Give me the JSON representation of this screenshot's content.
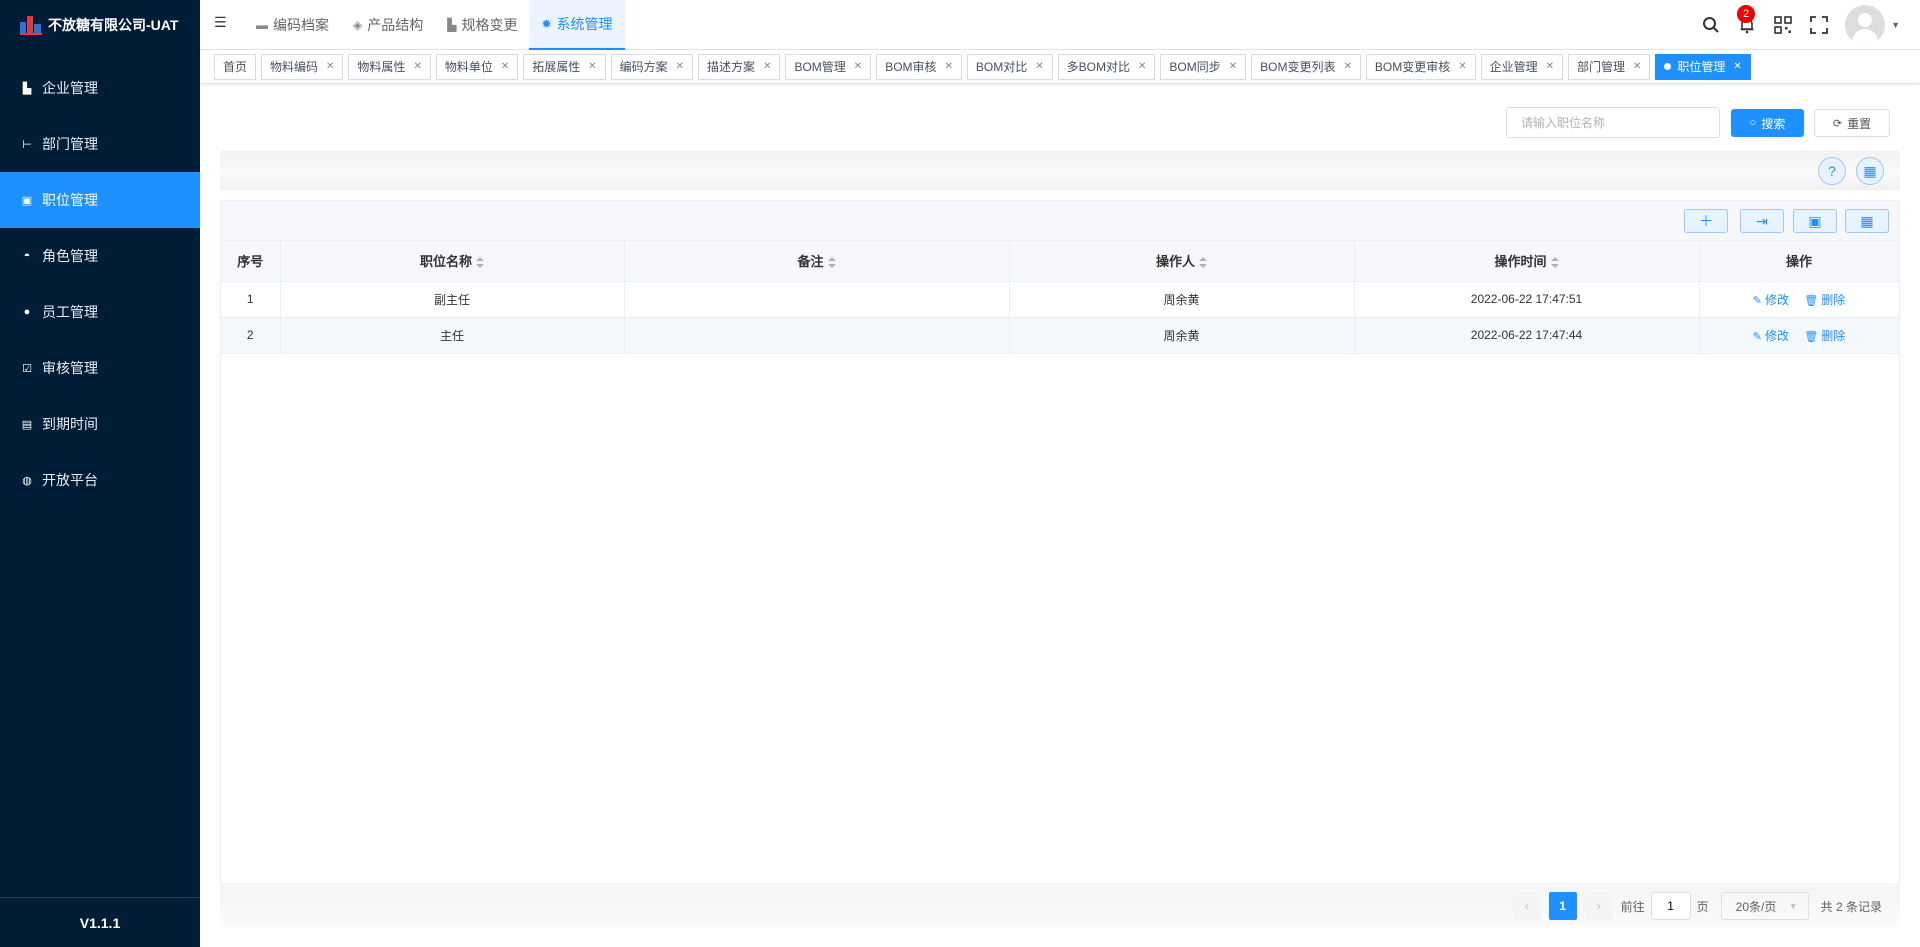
{
  "app": {
    "title": "不放糖有限公司-UAT",
    "version": "V1.1.1"
  },
  "sidebar": {
    "items": [
      {
        "label": "企业管理",
        "icon": "building-icon"
      },
      {
        "label": "部门管理",
        "icon": "tree-icon"
      },
      {
        "label": "职位管理",
        "icon": "id-card-icon",
        "active": true
      },
      {
        "label": "角色管理",
        "icon": "role-icon"
      },
      {
        "label": "员工管理",
        "icon": "user-icon"
      },
      {
        "label": "审核管理",
        "icon": "check-icon"
      },
      {
        "label": "到期时间",
        "icon": "calendar-icon"
      },
      {
        "label": "开放平台",
        "icon": "platform-icon"
      }
    ]
  },
  "topnav": {
    "items": [
      {
        "label": "编码档案"
      },
      {
        "label": "产品结构"
      },
      {
        "label": "规格变更"
      },
      {
        "label": "系统管理",
        "active": true
      }
    ],
    "notification_count": "2"
  },
  "tags": [
    "首页",
    "物料编码",
    "物料属性",
    "物料单位",
    "拓展属性",
    "编码方案",
    "描述方案",
    "BOM管理",
    "BOM审核",
    "BOM对比",
    "多BOM对比",
    "BOM同步",
    "BOM变更列表",
    "BOM变更审核",
    "企业管理",
    "部门管理",
    "职位管理"
  ],
  "search": {
    "placeholder": "请输入职位名称",
    "search_label": "搜索",
    "reset_label": "重置"
  },
  "table": {
    "columns": [
      "序号",
      "职位名称",
      "备注",
      "操作人",
      "操作时间",
      "操作"
    ],
    "rows": [
      {
        "index": "1",
        "name": "副主任",
        "remark": "",
        "operator": "周余黄",
        "time": "2022-06-22 17:47:51"
      },
      {
        "index": "2",
        "name": "主任",
        "remark": "",
        "operator": "周余黄",
        "time": "2022-06-22 17:47:44"
      }
    ],
    "edit_label": "修改",
    "delete_label": "删除"
  },
  "pagination": {
    "current": "1",
    "goto_prefix": "前往",
    "goto_value": "1",
    "goto_suffix": "页",
    "page_size": "20条/页",
    "total": "共 2 条记录"
  },
  "colors": {
    "sidebar_bg": "#011c36",
    "accent": "#1e90ff",
    "badge": "#ee0000"
  }
}
